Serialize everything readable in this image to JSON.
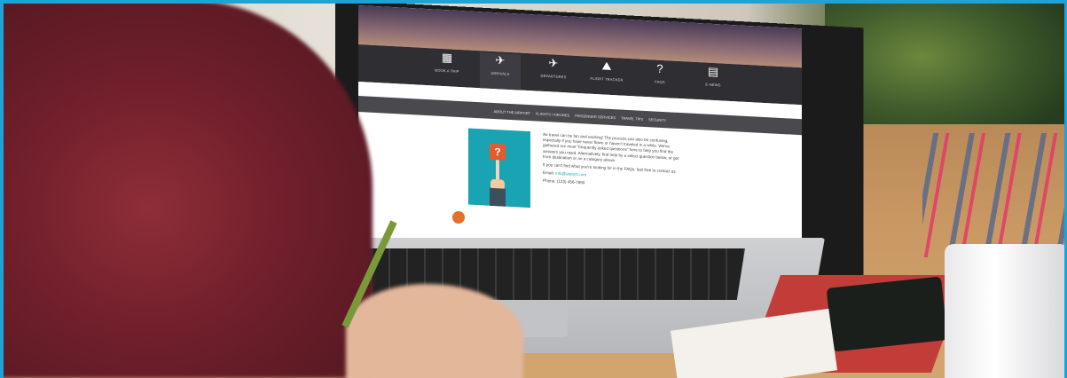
{
  "scene": {
    "description_colors": {
      "frame": "#1ea3d8",
      "accent": "#1aa3b2",
      "sign": "#e45a2a"
    }
  },
  "website": {
    "nav": [
      {
        "icon": "calendar-icon",
        "glyph": "▦",
        "label": "BOOK A TRIP"
      },
      {
        "icon": "arrivals-icon",
        "glyph": "✈",
        "label": "ARRIVALS"
      },
      {
        "icon": "departures-icon",
        "glyph": "✈",
        "label": "DEPARTURES"
      },
      {
        "icon": "flight-tracker-icon",
        "glyph": "⛰",
        "label": "FLIGHT TRACKER"
      },
      {
        "icon": "help-icon",
        "glyph": "?",
        "label": "FAQS"
      },
      {
        "icon": "news-icon",
        "glyph": "▤",
        "label": "E-NEWS"
      }
    ],
    "subnav": [
      "ABOUT THE AIRPORT",
      "FLIGHTS / AIRLINES",
      "PASSENGER SERVICES",
      "TRAVEL TIPS",
      "SECURITY"
    ],
    "faq_sign": "?",
    "paragraphs": [
      "Air travel can be fun and exciting! The process can also be confusing, especially if you have never flown or haven't traveled in a while. We've gathered our most \"frequently asked questions\" here to help you find the answers you need. Alternatively, find help by a select question below, or get from destination or on a category above.",
      "If you can't find what you're looking for in the FAQs, feel free to contact us."
    ],
    "email_label": "Email:",
    "email_value": "info@airport.com",
    "phone_label": "Phone:",
    "phone_value": "(123) 456-7890"
  }
}
